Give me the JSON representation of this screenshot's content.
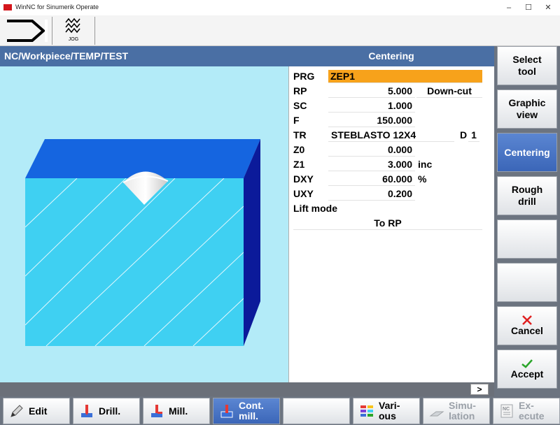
{
  "window": {
    "title": "WinNC for Sinumerik Operate",
    "minimize": "–",
    "maximize": "☐",
    "close": "✕"
  },
  "mode": {
    "jog_label": "JOG"
  },
  "header": {
    "path": "NC/Workpiece/TEMP/TEST",
    "cycle_title": "Centering"
  },
  "form": {
    "prg": {
      "label": "PRG",
      "value": "ZEP1"
    },
    "rp": {
      "label": "RP",
      "value": "5.000",
      "option": "Down-cut"
    },
    "sc": {
      "label": "SC",
      "value": "1.000"
    },
    "f": {
      "label": "F",
      "value": "150.000"
    },
    "tr": {
      "label": "TR",
      "value": "STEBLASTO 12X4",
      "d_label": "D",
      "d_value": "1"
    },
    "z0": {
      "label": "Z0",
      "value": "0.000"
    },
    "z1": {
      "label": "Z1",
      "value": "3.000",
      "unit": "inc"
    },
    "dxy": {
      "label": "DXY",
      "value": "60.000",
      "unit": "%"
    },
    "uxy": {
      "label": "UXY",
      "value": "0.200"
    },
    "lift_mode": {
      "label": "Lift mode",
      "value": "To RP"
    }
  },
  "softkeys_right": [
    {
      "label": "Select\ntool",
      "active": false
    },
    {
      "label": "Graphic\nview",
      "active": false
    },
    {
      "label": "Centering",
      "active": true
    },
    {
      "label": "Rough\ndrill",
      "active": false
    },
    {
      "label": "",
      "active": false
    },
    {
      "label": "",
      "active": false
    },
    {
      "label": "Cancel",
      "active": false
    },
    {
      "label": "Accept",
      "active": false
    }
  ],
  "status": {
    "more": ">"
  },
  "softkeys_bottom": [
    {
      "label": "Edit",
      "icon": "pencil-icon"
    },
    {
      "label": "Drill.",
      "icon": "drill-icon"
    },
    {
      "label": "Mill.",
      "icon": "mill-icon"
    },
    {
      "label": "Cont.\nmill.",
      "icon": "contour-mill-icon"
    },
    {
      "label": "",
      "icon": ""
    },
    {
      "label": "Vari-\nous",
      "icon": "various-icon"
    },
    {
      "label": "Simu-\nlation",
      "icon": "simulation-icon"
    },
    {
      "label": "Ex-\necute",
      "icon": "nc-execute-icon"
    }
  ],
  "colors": {
    "header_blue": "#4a6fa4",
    "active_blue": "#3b66b8",
    "prg_orange": "#f7a21b",
    "workpiece_cyan": "#3fd0f2",
    "workpiece_top": "#1565e0",
    "workpiece_side": "#0b1a9a",
    "graphic_bg": "#b3ebf8"
  }
}
